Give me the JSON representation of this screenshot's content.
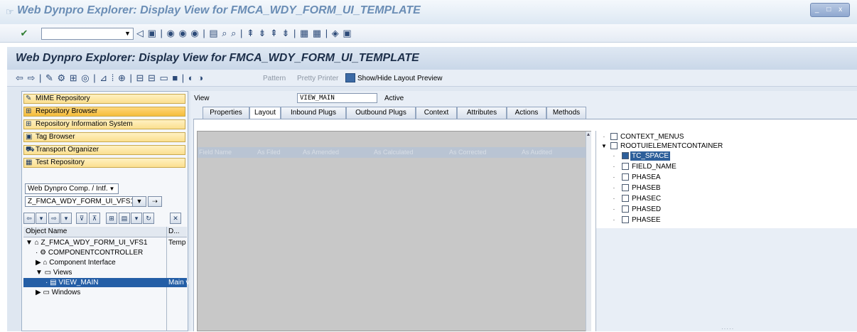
{
  "window": {
    "title": "Web Dynpro Explorer: Display View for FMCA_WDY_FORM_UI_TEMPLATE",
    "controls": "_ □ x"
  },
  "toolbar1": {
    "command_value": "",
    "icons": "◁ ▣ | ◉ ◉ ◉ | ▤ ⌕ ⌕ | ⇞ ⇟ ⇞ ⇟ | ▦ ▦ | ◈ ▣"
  },
  "main": {
    "title": "Web Dynpro Explorer: Display View for FMCA_WDY_FORM_UI_TEMPLATE"
  },
  "toolbar2": {
    "icons": "⇦ ⇨ | ✎ ⚙ ⊞ ◎ | ⊿ ⁞ ⊕ | ⊟ ⊟ ▭ ■ | ◐ ◑",
    "pattern": "Pattern",
    "pretty_printer": "Pretty Printer",
    "show_hide": "Show/Hide Layout Preview"
  },
  "sidebar": {
    "nav_items": [
      {
        "label": "MIME Repository",
        "icon": "✎"
      },
      {
        "label": "Repository Browser",
        "icon": "⊞"
      },
      {
        "label": "Repository Information System",
        "icon": "⊞"
      },
      {
        "label": "Tag Browser",
        "icon": "▣"
      },
      {
        "label": "Transport Organizer",
        "icon": "⛟"
      },
      {
        "label": "Test Repository",
        "icon": "▦"
      }
    ],
    "object_type": "Web Dynpro Comp. / Intf.",
    "object_name": "Z_FMCA_WDY_FORM_UI_VFS1",
    "tree_header": {
      "name": "Object Name",
      "desc": "D..."
    },
    "tree": [
      {
        "label": "Z_FMCA_WDY_FORM_UI_VFS1",
        "desc": "Temp",
        "prefix": "▼ ⌂ "
      },
      {
        "label": "COMPONENTCONTROLLER",
        "desc": "",
        "prefix": "· ⚙ "
      },
      {
        "label": "Component Interface",
        "desc": "",
        "prefix": "▶ ⌂ "
      },
      {
        "label": "Views",
        "desc": "",
        "prefix": "▼ ▭ "
      },
      {
        "label": "VIEW_MAIN",
        "desc": "Main v",
        "prefix": "· ▤ "
      },
      {
        "label": "Windows",
        "desc": "",
        "prefix": "▶ ▭ "
      }
    ]
  },
  "view": {
    "label": "View",
    "name": "VIEW_MAIN",
    "status": "Active",
    "tabs": [
      "Properties",
      "Layout",
      "Inbound Plugs",
      "Outbound Plugs",
      "Context",
      "Attributes",
      "Actions",
      "Methods"
    ],
    "grid_columns": [
      "Field Name",
      "As Filed",
      "As Amended",
      "As Calculated",
      "As Corrected",
      "As Audited"
    ]
  },
  "context_tree": [
    {
      "label": "CONTEXT_MENUS",
      "exp": "·"
    },
    {
      "label": "ROOTUIELEMENTCONTAINER",
      "exp": "▼"
    },
    {
      "label": "TC_SPACE",
      "exp": "·"
    },
    {
      "label": "FIELD_NAME",
      "exp": "·"
    },
    {
      "label": "PHASEA",
      "exp": "·"
    },
    {
      "label": "PHASEB",
      "exp": "·"
    },
    {
      "label": "PHASEC",
      "exp": "·"
    },
    {
      "label": "PHASED",
      "exp": "·"
    },
    {
      "label": "PHASEE",
      "exp": "·"
    }
  ],
  "colors": {
    "accent": "#245ea6",
    "nav_bg": "#fbdf8f",
    "grid_bg": "#c8c8c8"
  }
}
